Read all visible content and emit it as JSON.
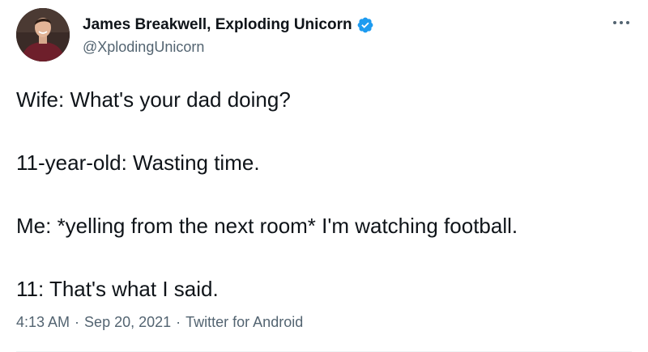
{
  "author": {
    "display_name": "James Breakwell, Exploding Unicorn",
    "handle": "@XplodingUnicorn",
    "verified": true,
    "verified_color": "#1d9bf0"
  },
  "tweet": {
    "lines": [
      "Wife: What's your dad doing?",
      "11-year-old: Wasting time.",
      "Me: *yelling from the next room* I'm watching football.",
      "11: That's what I said."
    ]
  },
  "meta": {
    "time": "4:13 AM",
    "separator": "·",
    "date": "Sep 20, 2021",
    "source": "Twitter for Android"
  },
  "icons": {
    "more": "more-icon",
    "verified": "verified-badge-icon"
  },
  "colors": {
    "text": "#0f1419",
    "secondary": "#536471",
    "accent": "#1d9bf0"
  }
}
